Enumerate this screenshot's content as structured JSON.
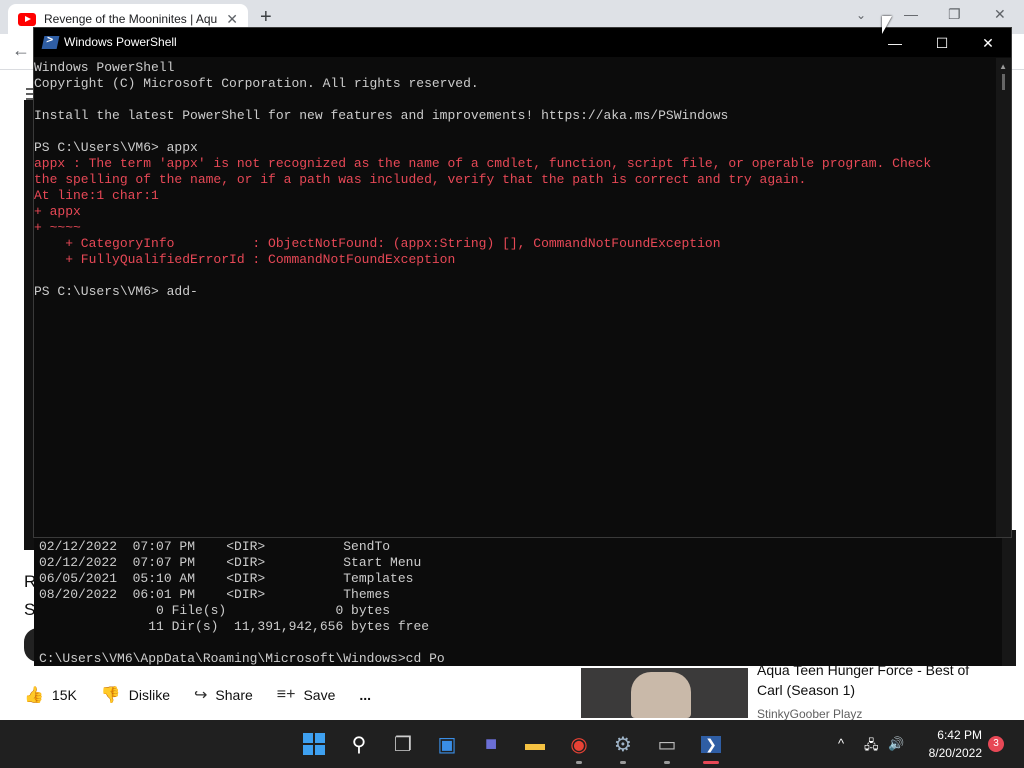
{
  "browser": {
    "tab_title": "Revenge of the Mooninites | Aqu",
    "tab_close": "✕",
    "new_tab": "+",
    "back": "←",
    "caret": "⌄",
    "minimize": "—",
    "restore": "❐",
    "close": "✕",
    "toolbar_right": "⋮"
  },
  "youtube": {
    "title_fragment_1": "R",
    "title_fragment_2": "S",
    "actions": [
      {
        "icon": "👍",
        "label": "15K"
      },
      {
        "icon": "👎",
        "label": "Dislike"
      },
      {
        "icon": "↪",
        "label": "Share"
      },
      {
        "icon": "≡+",
        "label": "Save"
      },
      {
        "icon": "",
        "label": "..."
      }
    ],
    "recommended": {
      "title": "Aqua Teen Hunger Force - Best of Carl (Season 1)",
      "channel": "StinkyGoober Playz"
    }
  },
  "cmd": {
    "lines": [
      "02/12/2022  07:07 PM    <DIR>          SendTo",
      "02/12/2022  07:07 PM    <DIR>          Start Menu",
      "06/05/2021  05:10 AM    <DIR>          Templates",
      "08/20/2022  06:01 PM    <DIR>          Themes",
      "               0 File(s)              0 bytes",
      "              11 Dir(s)  11,391,942,656 bytes free",
      "",
      "C:\\Users\\VM6\\AppData\\Roaming\\Microsoft\\Windows>cd Po"
    ]
  },
  "powershell": {
    "title": "Windows PowerShell",
    "minimize": "—",
    "maximize": "☐",
    "close": "✕",
    "lines": [
      {
        "text": "Windows PowerShell",
        "err": false
      },
      {
        "text": "Copyright (C) Microsoft Corporation. All rights reserved.",
        "err": false
      },
      {
        "text": "",
        "err": false
      },
      {
        "text": "Install the latest PowerShell for new features and improvements! https://aka.ms/PSWindows",
        "err": false
      },
      {
        "text": "",
        "err": false
      },
      {
        "text": "PS C:\\Users\\VM6> appx",
        "err": false
      },
      {
        "text": "appx : The term 'appx' is not recognized as the name of a cmdlet, function, script file, or operable program. Check",
        "err": true
      },
      {
        "text": "the spelling of the name, or if a path was included, verify that the path is correct and try again.",
        "err": true
      },
      {
        "text": "At line:1 char:1",
        "err": true
      },
      {
        "text": "+ appx",
        "err": true
      },
      {
        "text": "+ ~~~~",
        "err": true
      },
      {
        "text": "    + CategoryInfo          : ObjectNotFound: (appx:String) [], CommandNotFoundException",
        "err": true
      },
      {
        "text": "    + FullyQualifiedErrorId : CommandNotFoundException",
        "err": true
      },
      {
        "text": "",
        "err": false
      },
      {
        "text": "PS C:\\Users\\VM6> add-",
        "err": false
      }
    ]
  },
  "taskbar": {
    "icons": [
      {
        "name": "start-icon",
        "glyph": ""
      },
      {
        "name": "search-icon",
        "glyph": "⚲"
      },
      {
        "name": "task-view-icon",
        "glyph": "❐"
      },
      {
        "name": "widgets-icon",
        "glyph": "▣"
      },
      {
        "name": "teams-chat-icon",
        "glyph": "■"
      },
      {
        "name": "file-explorer-icon",
        "glyph": "▬"
      },
      {
        "name": "chrome-icon",
        "glyph": "◉"
      },
      {
        "name": "settings-icon",
        "glyph": "⚙"
      },
      {
        "name": "command-prompt-icon",
        "glyph": "▭"
      },
      {
        "name": "powershell-icon",
        "glyph": "❯"
      }
    ],
    "tray": {
      "chevron": "^",
      "network": "🖧",
      "volume": "🔊",
      "time": "6:42 PM",
      "date": "8/20/2022",
      "notifications": "3"
    }
  }
}
